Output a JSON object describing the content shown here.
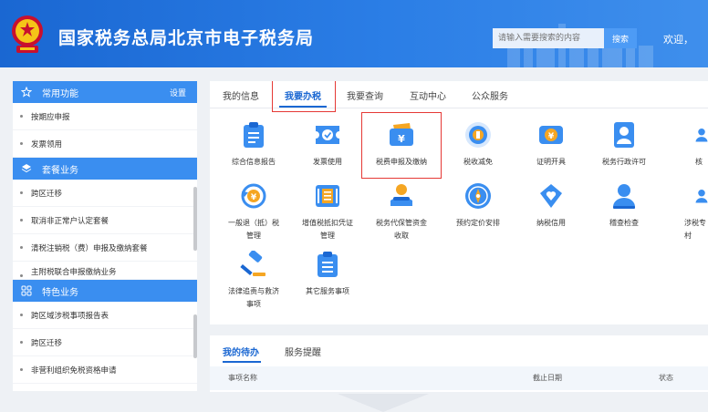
{
  "header": {
    "site_title": "国家税务总局北京市电子税务局",
    "search_placeholder": "请输入需要搜索的内容",
    "search_label": "搜索",
    "welcome": "欢迎，"
  },
  "sidebar": {
    "sections": [
      {
        "title": "常用功能",
        "icon": "star-icon",
        "setting_label": "设置",
        "items": [
          {
            "label": "按期应申报"
          },
          {
            "label": "发票领用"
          }
        ]
      },
      {
        "title": "套餐业务",
        "icon": "layers-icon",
        "items": [
          {
            "label": "跨区迁移"
          },
          {
            "label": "取消非正常户认定套餐"
          },
          {
            "label": "清税注销税（费）申报及缴纳套餐"
          },
          {
            "label": "主附税联合申报缴纳业务"
          }
        ]
      },
      {
        "title": "特色业务",
        "icon": "grid-icon",
        "items": [
          {
            "label": "跨区域涉税事项报告表"
          },
          {
            "label": "跨区迁移"
          },
          {
            "label": "非营利组织免税资格申请"
          }
        ]
      }
    ]
  },
  "main": {
    "tabs": [
      {
        "label": "我的信息",
        "active": false
      },
      {
        "label": "我要办税",
        "active": true
      },
      {
        "label": "我要查询",
        "active": false
      },
      {
        "label": "互动中心",
        "active": false
      },
      {
        "label": "公众服务",
        "active": false
      }
    ],
    "services": [
      {
        "label": "综合信息报告",
        "icon": "clipboard-icon"
      },
      {
        "label": "发票使用",
        "icon": "ticket-check-icon"
      },
      {
        "label": "税费申报及缴纳",
        "icon": "wallet-yuan-icon"
      },
      {
        "label": "税收减免",
        "icon": "coin-bar-icon"
      },
      {
        "label": "证明开具",
        "icon": "certificate-yuan-icon"
      },
      {
        "label": "税务行政许可",
        "icon": "person-card-icon"
      },
      {
        "label": "核",
        "icon": "person-icon"
      },
      {
        "label": "一般退（抵）税管理",
        "icon": "refund-yuan-icon"
      },
      {
        "label": "增值税抵扣凭证管理",
        "icon": "invoice-stack-icon"
      },
      {
        "label": "税务代保管资金收取",
        "icon": "hand-money-icon"
      },
      {
        "label": "预约定价安排",
        "icon": "compass-icon"
      },
      {
        "label": "纳税信用",
        "icon": "shield-heart-icon"
      },
      {
        "label": "稽查检查",
        "icon": "person-search-icon"
      },
      {
        "label": "涉税专",
        "icon": "person-icon"
      },
      {
        "label": "法律追责与救济事项",
        "icon": "gavel-icon"
      },
      {
        "label": "其它服务事项",
        "icon": "clipboard-list-icon"
      }
    ]
  },
  "todo": {
    "tabs": [
      {
        "label": "我的待办",
        "active": true
      },
      {
        "label": "服务提醒",
        "active": false
      }
    ],
    "columns": [
      "事项名称",
      "截止日期",
      "状态"
    ]
  },
  "colors": {
    "brand_blue": "#1a67d2",
    "accent_blue": "#3a8ef0",
    "highlight_red": "#e53935"
  }
}
